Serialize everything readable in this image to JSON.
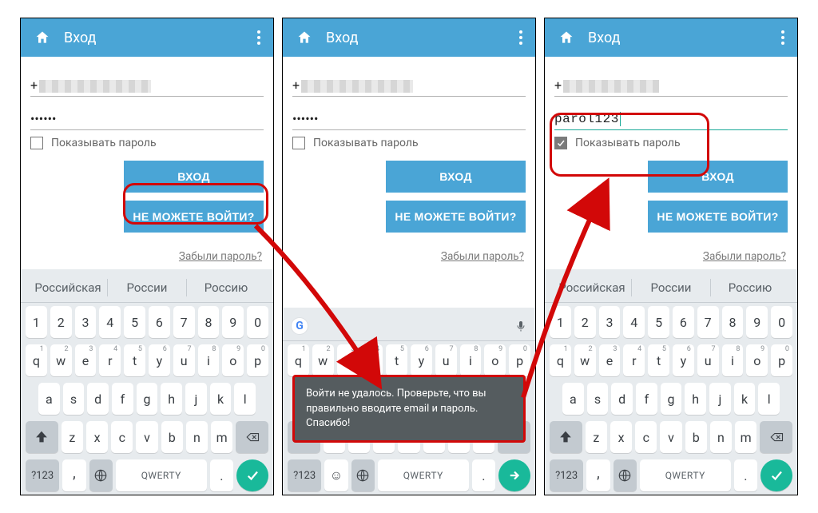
{
  "header": {
    "title": "Вход"
  },
  "fields": {
    "phone_prefix": "+",
    "password_masked": "••••••",
    "password_visible": "parol123"
  },
  "checkbox": {
    "label": "Показывать пароль"
  },
  "buttons": {
    "login": "ВХОД",
    "cant": "НЕ МОЖЕТЕ ВОЙТИ?"
  },
  "links": {
    "forgot": "Забыли пароль?"
  },
  "toast": "Войти не удалось. Проверьте, что вы правильно вводите email и пароль. Спасибо!",
  "kb": {
    "suggestions": [
      "Российская",
      "России",
      "Россию"
    ],
    "row_digits": [
      "1",
      "2",
      "3",
      "4",
      "5",
      "6",
      "7",
      "8",
      "9",
      "0"
    ],
    "row1": [
      "q",
      "w",
      "e",
      "r",
      "t",
      "y",
      "u",
      "i",
      "o",
      "p"
    ],
    "row2": [
      "a",
      "s",
      "d",
      "f",
      "g",
      "h",
      "j",
      "k",
      "l"
    ],
    "row3": [
      "z",
      "x",
      "c",
      "v",
      "b",
      "n",
      "m"
    ],
    "sym": "?123",
    "space": "QWERTY",
    "comma": ",",
    "dot": "."
  }
}
